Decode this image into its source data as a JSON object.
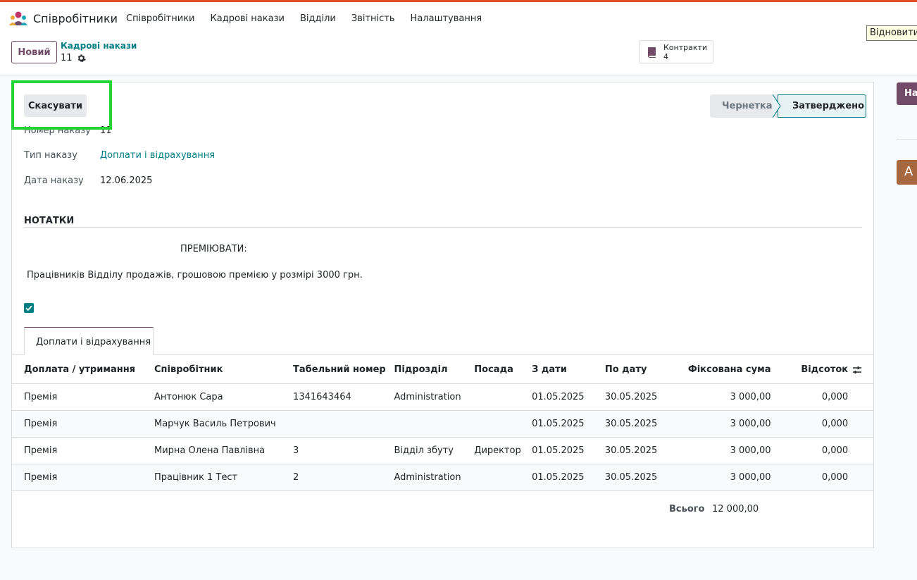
{
  "app": {
    "name": "Співробітники"
  },
  "menu": [
    "Співробітники",
    "Кадрові накази",
    "Відділи",
    "Звітність",
    "Налаштування"
  ],
  "tooltip": "Відновити",
  "control": {
    "new_label": "Новий",
    "breadcrumb": "Кадрові накази",
    "record": "11",
    "smart_button": {
      "label": "Контракти",
      "count": "4"
    }
  },
  "side": {
    "button": "На",
    "avatar": "A"
  },
  "form": {
    "cancel_label": "Скасувати",
    "stages": {
      "draft": "Чернетка",
      "approved": "Затверджено"
    },
    "fields": [
      {
        "label": "Номер наказу",
        "value": "11"
      },
      {
        "label": "Тип наказу",
        "value": "Доплати і відрахування"
      },
      {
        "label": "Дата наказу",
        "value": "12.06.2025"
      }
    ],
    "notes_title": "НОТАТКИ",
    "notes_line1": "ПРЕМІЮВАТИ:",
    "notes_line2": "Працівників Відділу продажів, грошовою премією у розмірі 3000 грн.",
    "tab": "Доплати і відрахування"
  },
  "table": {
    "headers": [
      "Доплата / утримання",
      "Співробітник",
      "Табельний номер",
      "Підрозділ",
      "Посада",
      "З дати",
      "По дату",
      "Фіксована сума",
      "Відсоток"
    ],
    "rows": [
      [
        "Премія",
        "Антонюк Сара",
        "1341643464",
        "Administration",
        "",
        "01.05.2025",
        "30.05.2025",
        "3 000,00",
        "0,000"
      ],
      [
        "Премія",
        "Марчук Василь Петрович",
        "",
        "",
        "",
        "01.05.2025",
        "30.05.2025",
        "3 000,00",
        "0,000"
      ],
      [
        "Премія",
        "Мирна Олена Павлівна",
        "3",
        "Відділ збуту",
        "Директор",
        "01.05.2025",
        "30.05.2025",
        "3 000,00",
        "0,000"
      ],
      [
        "Премія",
        "Працівник 1 Тест",
        "2",
        "Administration",
        "",
        "01.05.2025",
        "30.05.2025",
        "3 000,00",
        "0,000"
      ]
    ],
    "total_label": "Всього",
    "total_value": "12 000,00"
  },
  "colors": {
    "brand": "#714b67",
    "accent": "#017e84",
    "highlight": "#22d436"
  }
}
